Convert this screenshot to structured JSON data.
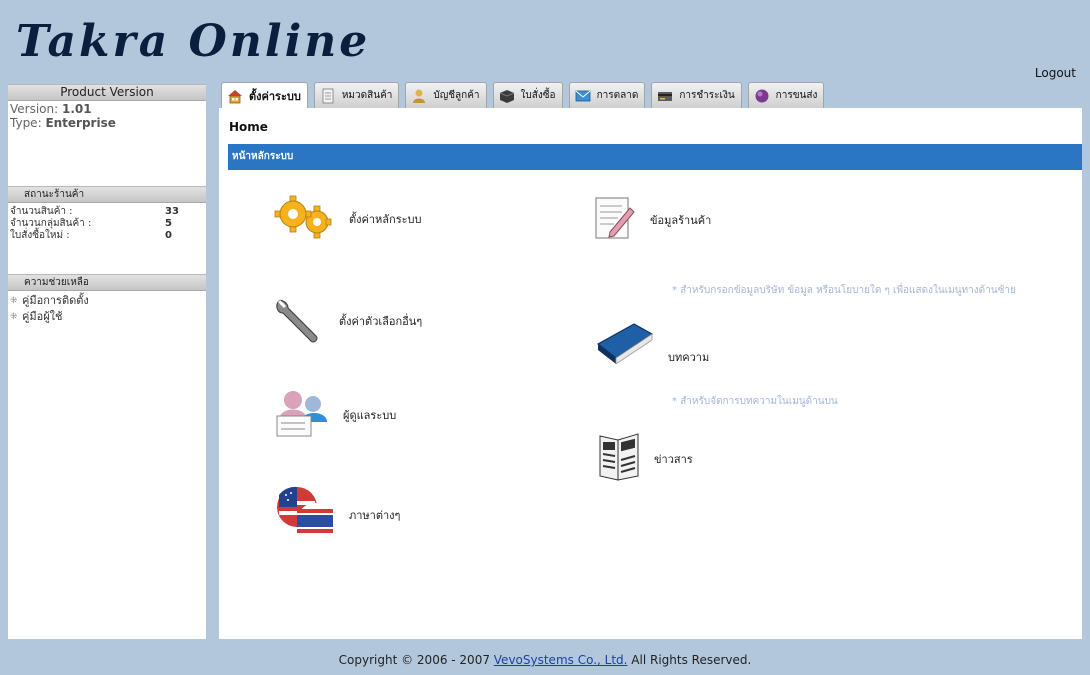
{
  "header": {
    "logo": "Takra Online",
    "logout": "Logout"
  },
  "sidebar": {
    "product": {
      "heading": "Product Version",
      "version_label": "Version:",
      "version_value": "1.01",
      "type_label": "Type:",
      "type_value": "Enterprise"
    },
    "store": {
      "heading": "สถานะร้านค้า",
      "rows": [
        {
          "label": "จำนวนสินค้า :",
          "value": "33"
        },
        {
          "label": "จำนวนกลุ่มสินค้า :",
          "value": "5"
        },
        {
          "label": "ใบสั่งซื้อใหม่ :",
          "value": "0"
        }
      ]
    },
    "help": {
      "heading": "ความช่วยเหลือ",
      "items": [
        {
          "label": "คู่มือการติดตั้ง"
        },
        {
          "label": "คู่มือผู้ใช้"
        }
      ]
    }
  },
  "tabs": [
    {
      "label": "ตั้งค่าระบบ",
      "icon": "home-icon",
      "color": "#d89a2b"
    },
    {
      "label": "หมวดสินค้า",
      "icon": "document-icon",
      "color": "#8b8b8b"
    },
    {
      "label": "บัญชีลูกค้า",
      "icon": "user-account-icon",
      "color": "#c9932e"
    },
    {
      "label": "ใบสั่งซื้อ",
      "icon": "box-icon",
      "color": "#3b3b3b"
    },
    {
      "label": "การตลาด",
      "icon": "mail-icon",
      "color": "#3d8fd3"
    },
    {
      "label": "การชำระเงิน",
      "icon": "payment-icon",
      "color": "#5a5a5a"
    },
    {
      "label": "การขนส่ง",
      "icon": "shipping-icon",
      "color": "#7b3a8f"
    }
  ],
  "main": {
    "breadcrumb": "Home",
    "section_title": "หน้าหลักระบบ",
    "left_items": [
      {
        "label": "ตั้งค่าหลักระบบ",
        "icon": "gears-icon"
      },
      {
        "label": "ตั้งค่าตัวเลือกอื่นๆ",
        "icon": "wrench-icon"
      },
      {
        "label": "ผู้ดูแลระบบ",
        "icon": "admin-users-icon"
      },
      {
        "label": "ภาษาต่างๆ",
        "icon": "language-flags-icon"
      }
    ],
    "right_items": [
      {
        "label": "ข้อมูลร้านค้า",
        "icon": "document-edit-icon"
      },
      {
        "label": "บทความ",
        "icon": "book-icon"
      },
      {
        "label": "ข่าวสาร",
        "icon": "newspaper-icon"
      }
    ],
    "notes": [
      "* สำหรับกรอกข้อมูลบริษัท ข้อมูล หรือนโยบายใด ๆ เพื่อแสดงในเมนูทางด้านซ้าย",
      "* สำหรับจัดการบทความในเมนูด้านบน"
    ]
  },
  "footer": {
    "prefix": "Copyright © 2006 - 2007 ",
    "link": "VevoSystems Co., Ltd.",
    "suffix": " All Rights Reserved."
  },
  "colors": {
    "background": "#b3c7dc",
    "section_bar": "#2a76c4",
    "note_text": "#a6b5d6"
  }
}
